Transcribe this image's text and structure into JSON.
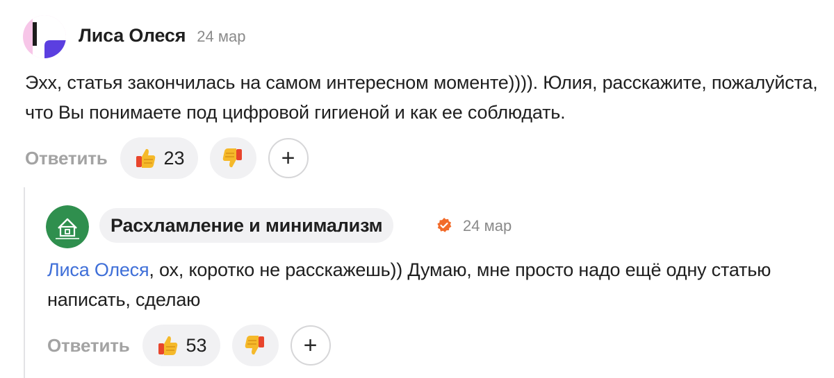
{
  "top_comment": {
    "author": "Лиса Олеся",
    "date": "24 мар",
    "text": "Эхх, статья закончилась на самом интересном моменте)))). Юлия, расскажите, пожалуйста, что Вы понимаете под цифровой гигиеной и как ее соблюдать.",
    "reply_label": "Ответить",
    "likes": "23",
    "add_reaction": "+"
  },
  "reply_comment": {
    "author": "Расхламление и минимализм",
    "date": "24 мар",
    "mention": "Лиса Олеся",
    "text": ", ох, коротко не расскажешь)) Думаю, мне просто надо ещё одну статью написать, сделаю",
    "reply_label": "Ответить",
    "likes": "53",
    "add_reaction": "+"
  },
  "icons": {
    "like": "thumbs-up-icon",
    "dislike": "thumbs-down-icon",
    "verified": "verified-badge-icon",
    "add": "plus-icon"
  },
  "colors": {
    "mention": "#3f6fd8",
    "verified": "#f26b2a",
    "channel_avatar": "#2f8f4e",
    "muted_text": "#a3a3a3"
  }
}
